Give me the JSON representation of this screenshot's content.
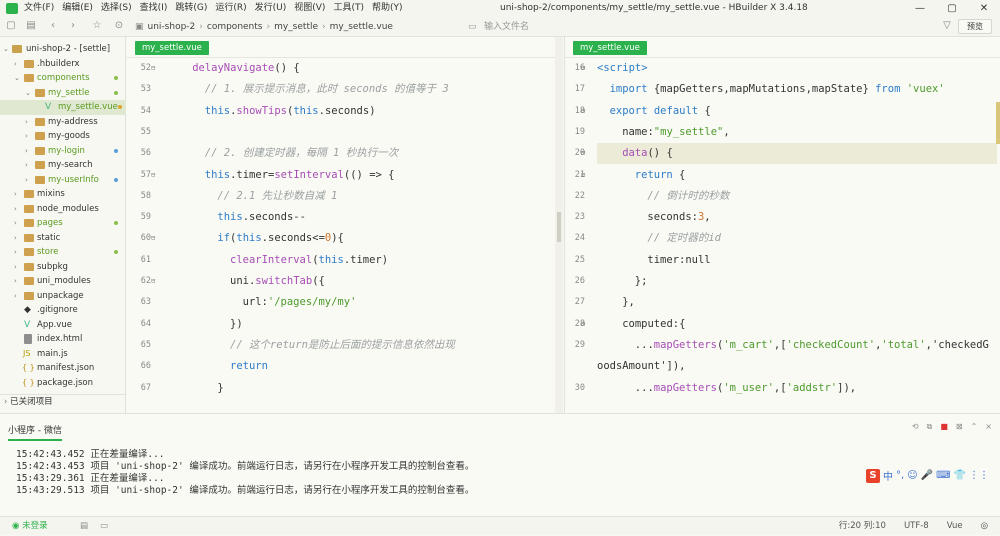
{
  "menu": [
    "文件(F)",
    "编辑(E)",
    "选择(S)",
    "查找(I)",
    "跳转(G)",
    "运行(R)",
    "发行(U)",
    "视图(V)",
    "工具(T)",
    "帮助(Y)"
  ],
  "window_title": "uni-shop-2/components/my_settle/my_settle.vue - HBuilder X 3.4.18",
  "window_controls": [
    "—",
    "▢",
    "✕"
  ],
  "breadcrumb": [
    "uni-shop-2",
    "components",
    "my_settle",
    "my_settle.vue"
  ],
  "search": {
    "placeholder": "输入文件名"
  },
  "preview_label": "预览",
  "sidebar": {
    "items": [
      {
        "label": "uni-shop-2 - [settle]",
        "arrow": "⌄"
      },
      {
        "label": ".hbuilderx",
        "arrow": "›"
      },
      {
        "label": "components",
        "arrow": "⌄"
      },
      {
        "label": "my_settle",
        "arrow": "⌄"
      },
      {
        "label": "my_settle.vue",
        "arrow": ""
      },
      {
        "label": "my-address",
        "arrow": "›"
      },
      {
        "label": "my-goods",
        "arrow": "›"
      },
      {
        "label": "my-login",
        "arrow": "›"
      },
      {
        "label": "my-search",
        "arrow": "›"
      },
      {
        "label": "my-userInfo",
        "arrow": "›"
      },
      {
        "label": "mixins",
        "arrow": "›"
      },
      {
        "label": "node_modules",
        "arrow": "›"
      },
      {
        "label": "pages",
        "arrow": "›"
      },
      {
        "label": "static",
        "arrow": "›"
      },
      {
        "label": "store",
        "arrow": "›"
      },
      {
        "label": "subpkg",
        "arrow": "›"
      },
      {
        "label": "uni_modules",
        "arrow": "›"
      },
      {
        "label": "unpackage",
        "arrow": "›"
      },
      {
        "label": ".gitignore",
        "arrow": ""
      },
      {
        "label": "App.vue",
        "arrow": ""
      },
      {
        "label": "index.html",
        "arrow": ""
      },
      {
        "label": "main.js",
        "arrow": ""
      },
      {
        "label": "manifest.json",
        "arrow": ""
      },
      {
        "label": "package.json",
        "arrow": ""
      }
    ],
    "closed_section": "已关闭项目",
    "icons": {
      "js": "JS",
      "json": "{ }",
      "vue": "V"
    }
  },
  "left_editor": {
    "tab": "my_settle.vue",
    "line_numbers": [
      "52",
      "53",
      "54",
      "55",
      "56",
      "57",
      "58",
      "59",
      "60",
      "61",
      "62",
      "63",
      "64",
      "65",
      "66",
      "67"
    ],
    "lines": [
      "delayNavigate() {",
      "// 1. 展示提示消息，此时 seconds 的值等于 3",
      "this.showTips(this.seconds)",
      "",
      "// 2. 创建定时器，每隔 1 秒执行一次",
      "this.timer=setInterval(() => {",
      "// 2.1 先让秒数自减 1",
      "this.seconds--",
      "if(this.seconds<=0){",
      "clearInterval(this.timer)",
      "uni.switchTab({",
      "url:'/pages/my/my'",
      "})",
      "// 这个return是防止后面的提示信息依然出现",
      "return",
      "}"
    ]
  },
  "right_editor": {
    "tab": "my_settle.vue",
    "line_numbers": [
      "16",
      "17",
      "18",
      "19",
      "20",
      "21",
      "22",
      "23",
      "24",
      "25",
      "26",
      "27",
      "28",
      "29",
      "",
      "30"
    ],
    "lines": [
      "<script>",
      "import {mapGetters,mapMutations,mapState} from 'vuex'",
      "export default {",
      "name:\"my_settle\",",
      "data() {",
      "return {",
      "// 倒计时的秒数",
      "seconds:3,",
      "// 定时器的id",
      "timer:null",
      "};",
      "},",
      "computed:{",
      "...mapGetters('m_cart',['checkedCount','total','checkedG",
      "oodsAmount']),",
      "...mapGetters('m_user',['addstr']),"
    ]
  },
  "console": {
    "title": "小程序 - 微信",
    "controls": [
      "⟲",
      "⧉",
      "■",
      "⊠",
      "⌃",
      "⨯"
    ],
    "logs": [
      "15:42:43.452 正在差量编译...",
      "15:42:43.453 项目 'uni-shop-2' 编译成功。前端运行日志，请另行在小程序开发工具的控制台查看。",
      "15:43:29.361 正在差量编译...",
      "15:43:29.513 项目 'uni-shop-2' 编译成功。前端运行日志，请另行在小程序开发工具的控制台查看。"
    ]
  },
  "ime": {
    "logo": "S",
    "items": [
      "中",
      "°,",
      "☺",
      "🎤",
      "⌨",
      "👕",
      "⋮⋮"
    ]
  },
  "status": {
    "login": "未登录",
    "position": "行:20 列:10",
    "encoding": "UTF-8",
    "language": "Vue"
  }
}
